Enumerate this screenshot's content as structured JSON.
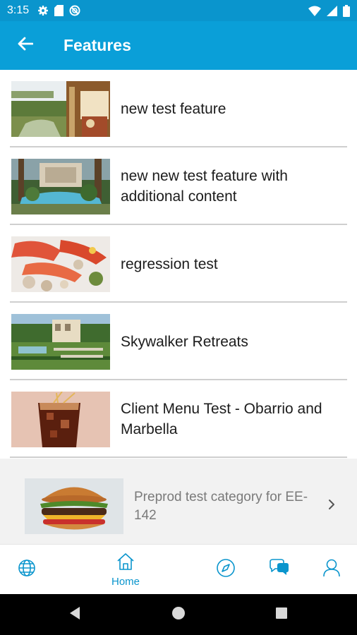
{
  "status_bar": {
    "time": "3:15",
    "icons": [
      "gear-icon",
      "sim-card-icon",
      "no-disturb-icon",
      "wifi-icon",
      "signal-icon",
      "battery-icon"
    ]
  },
  "app_bar": {
    "back_icon": "arrow-left-icon",
    "title": "Features"
  },
  "features": [
    {
      "title": "new test feature",
      "thumbnail": "resort-terrace-image"
    },
    {
      "title": "new new test feature with additional content",
      "thumbnail": "resort-pool-image"
    },
    {
      "title": "regression test",
      "thumbnail": "seafood-platter-image"
    },
    {
      "title": "Skywalker Retreats",
      "thumbnail": "villa-garden-image"
    },
    {
      "title": "Client Menu Test - Obarrio and Marbella",
      "thumbnail": "cola-glass-image"
    }
  ],
  "category": {
    "title": "Preprod test category for EE-142",
    "thumbnail": "burger-image",
    "chevron_icon": "chevron-right-icon"
  },
  "bottom_nav": {
    "items": [
      {
        "icon": "globe-icon",
        "label": ""
      },
      {
        "icon": "home-icon",
        "label": "Home"
      },
      {
        "icon": "compass-icon",
        "label": ""
      },
      {
        "icon": "chat-icon",
        "label": ""
      },
      {
        "icon": "user-icon",
        "label": ""
      }
    ]
  },
  "system_nav": {
    "icons": [
      "back-triangle-icon",
      "home-circle-icon",
      "recents-square-icon"
    ]
  },
  "colors": {
    "status_bar": "#0a95cd",
    "app_bar": "#0a9fd8",
    "accent": "#0a95cd",
    "category_bg": "#f2f2f2"
  }
}
